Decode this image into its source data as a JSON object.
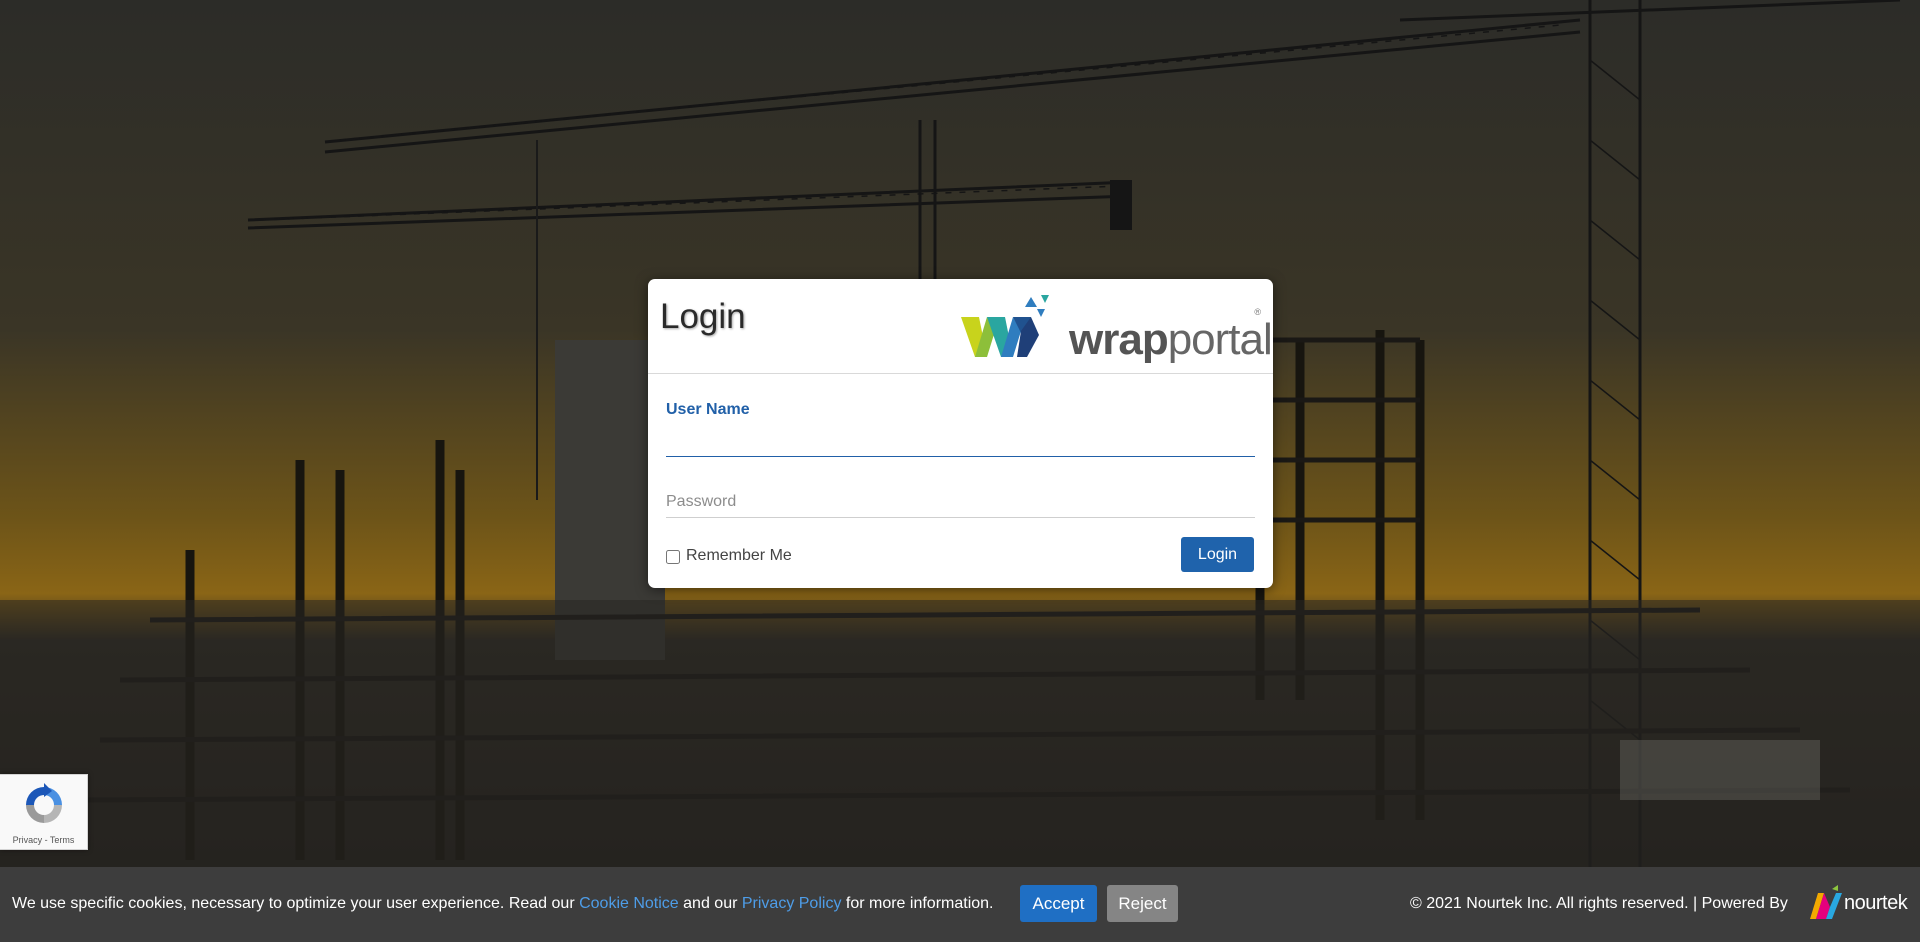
{
  "login": {
    "title": "Login",
    "brand": {
      "part1": "wrap",
      "part2": "portal",
      "registered": "®"
    },
    "username_label": "User Name",
    "username_value": "",
    "password_placeholder": "Password",
    "password_value": "",
    "remember_label": "Remember Me",
    "remember_checked": false,
    "submit_label": "Login"
  },
  "recaptcha": {
    "links": "Privacy - Terms"
  },
  "cookie_bar": {
    "text_before": "We use specific cookies, necessary to optimize your user experience. Read our ",
    "cookie_link": "Cookie Notice",
    "text_middle": " and our ",
    "privacy_link": "Privacy Policy",
    "text_after": " for more information.",
    "accept_label": "Accept",
    "reject_label": "Reject"
  },
  "footer": {
    "copyright": "© 2021  Nourtek Inc. All rights reserved. | Powered By",
    "powered_brand": "nourtek"
  },
  "colors": {
    "accent_blue": "#1f63ac",
    "link_blue": "#4e9de8",
    "reject_gray": "#858585"
  }
}
